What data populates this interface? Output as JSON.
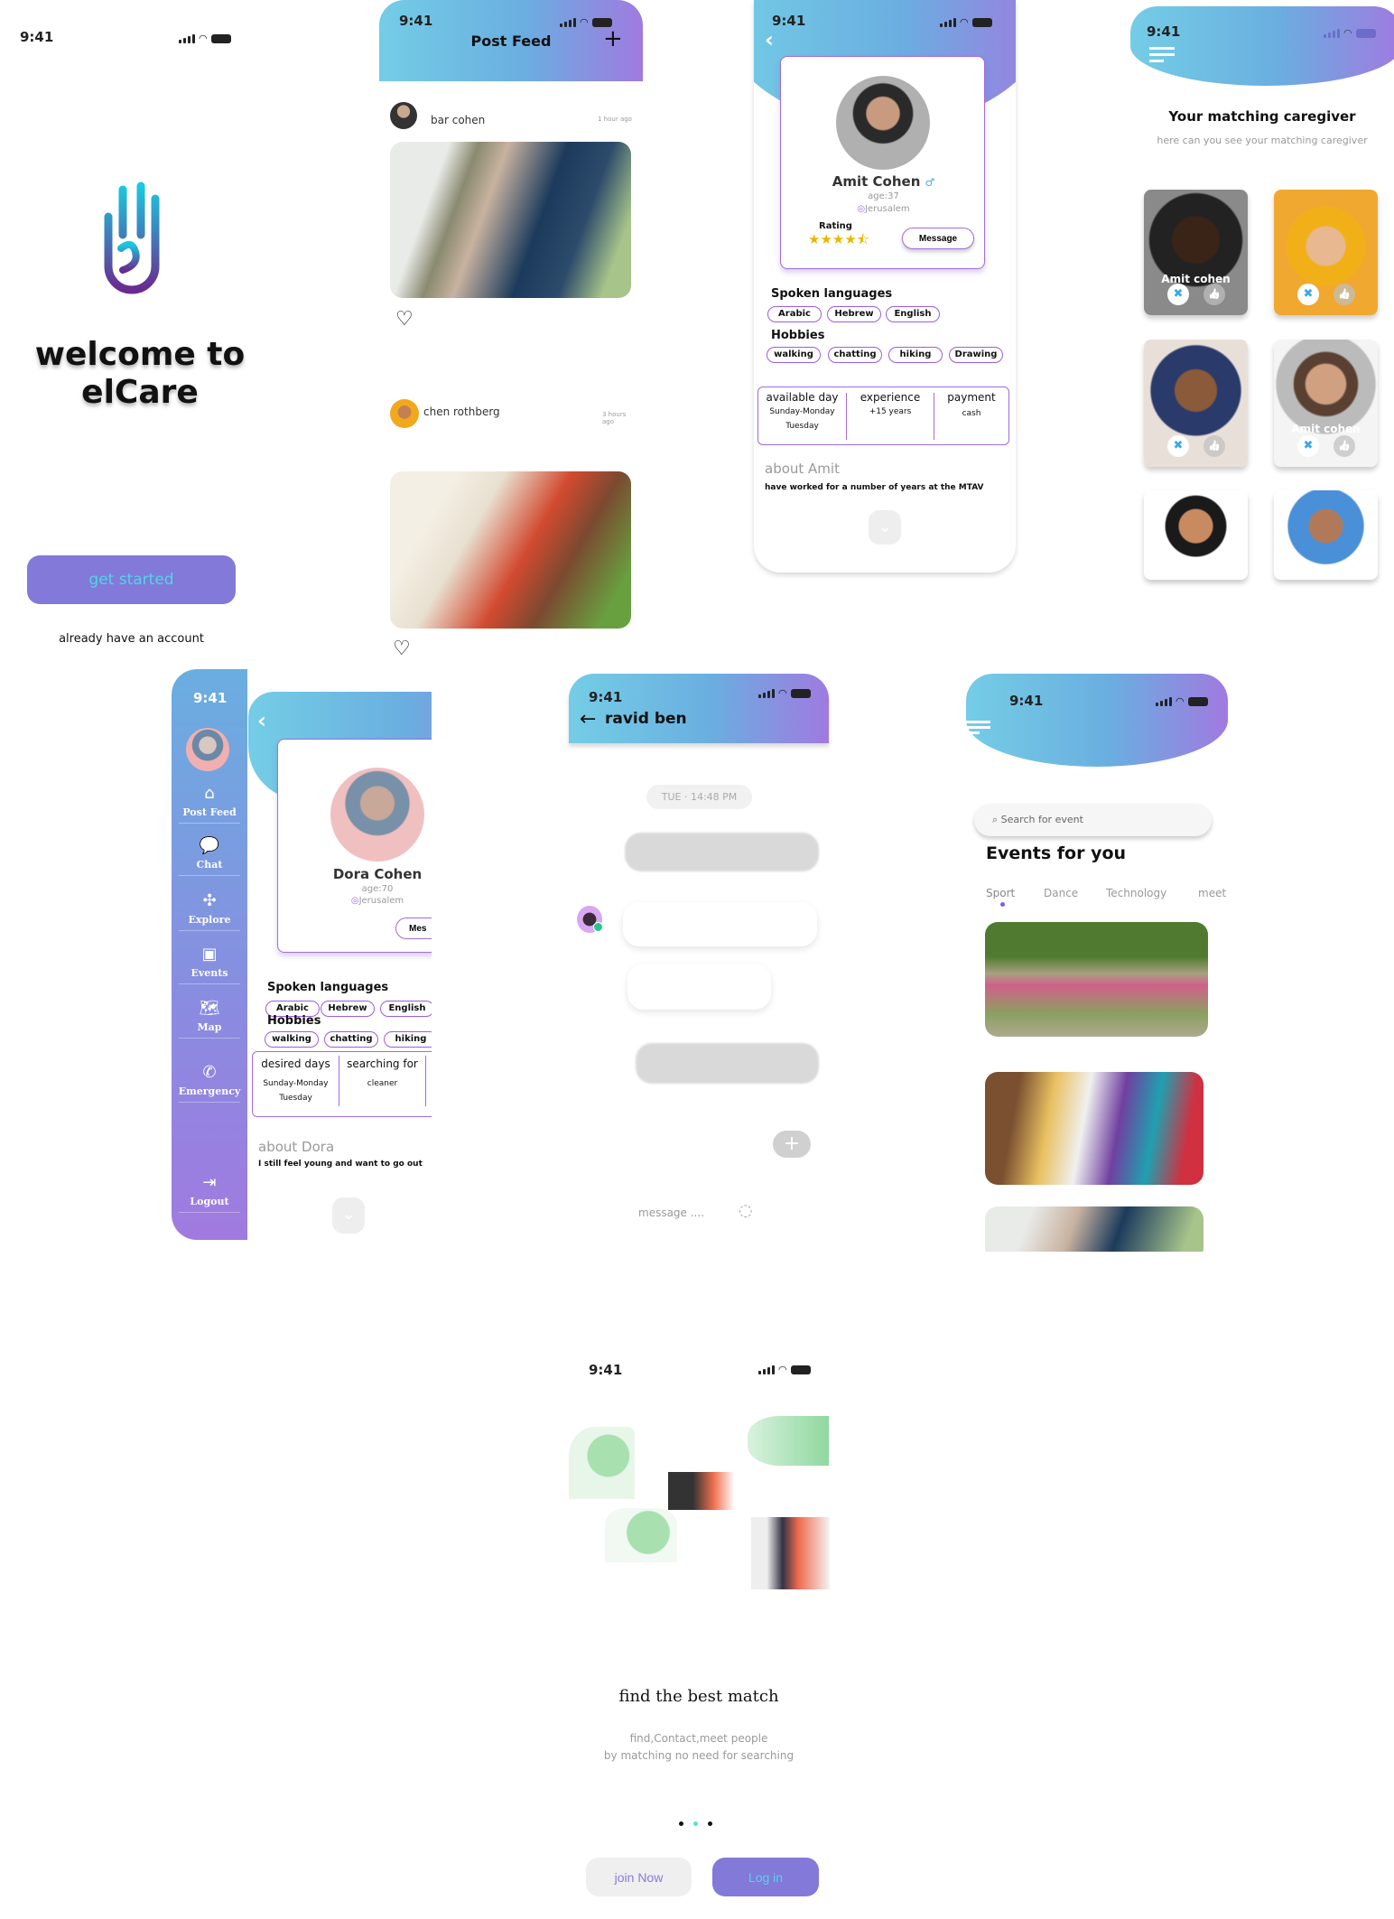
{
  "status_time": "9:41",
  "welcome": {
    "title_line1": "welcome to",
    "title_line2": "elCare",
    "get_started": "get started",
    "already": "already have an account"
  },
  "feed": {
    "title": "Post Feed",
    "add": "+",
    "posts": [
      {
        "name": "bar cohen",
        "time": "1 hour ago"
      },
      {
        "name": "chen rothberg",
        "time": "3 hours ago"
      }
    ]
  },
  "amit": {
    "name": "Amit Cohen",
    "age": "age:37",
    "location": "Jerusalem",
    "rating_label": "Rating",
    "stars": "★★★★⯪",
    "rating_value": 4.5,
    "message": "Message",
    "spoken_title": "Spoken languages",
    "languages": [
      "Arabic",
      "Hebrew",
      "English"
    ],
    "hobbies_title": "Hobbies",
    "hobbies": [
      "walking",
      "chatting",
      "hiking",
      "Drawing"
    ],
    "table": {
      "h1": "available day",
      "v1a": "Sunday-Monday",
      "v1b": "Tuesday",
      "h2": "experience",
      "v2": "+15 years",
      "h3": "payment",
      "v3": "cash"
    },
    "about_title": "about Amit",
    "about_text": "have worked for a number of years at the MTAV"
  },
  "matching": {
    "title": "Your matching caregiver",
    "subtitle": "here can you see your matching caregiver",
    "cards": [
      {
        "label": "Amit cohen"
      },
      {
        "label": ""
      },
      {
        "label": ""
      },
      {
        "label": "Amit cohen"
      },
      {
        "label": ""
      },
      {
        "label": ""
      }
    ]
  },
  "dora": {
    "sidebar": [
      "Post Feed",
      "Chat",
      "Explore",
      "Events",
      "Map",
      "Emergency",
      "Logout"
    ],
    "name": "Dora Cohen",
    "age": "age:70",
    "location": "Jerusalem",
    "message": "Mes",
    "spoken_title": "Spoken languages",
    "languages": [
      "Arabic",
      "Hebrew",
      "English"
    ],
    "hobbies_title": "Hobbies",
    "hobbies": [
      "walking",
      "chatting",
      "hiking"
    ],
    "table": {
      "h1": "desired days",
      "v1a": "Sunday-Monday",
      "v1b": "Tuesday",
      "h2": "searching for",
      "v2": "cleaner"
    },
    "about_title": "about Dora",
    "about_text": "I still feel young and want to go out"
  },
  "chat": {
    "contact": "ravid ben",
    "timestamp": "TUE · 14:48 PM",
    "placeholder": "message ....",
    "plus": "+"
  },
  "events": {
    "search_placeholder": "Search for event",
    "title": "Events for you",
    "tabs": [
      "Sport",
      "Dance",
      "Technology",
      "meet"
    ]
  },
  "onboarding": {
    "title": "find the best match",
    "line1": "find,Contact,meet people",
    "line2": "by matching no need for searching",
    "join": "join Now",
    "login": "Log in",
    "active_dot": 1
  },
  "colors": {
    "button": "#8279d8",
    "accent_text": "#4fd6e6",
    "chip_border": "#9b5de5"
  }
}
